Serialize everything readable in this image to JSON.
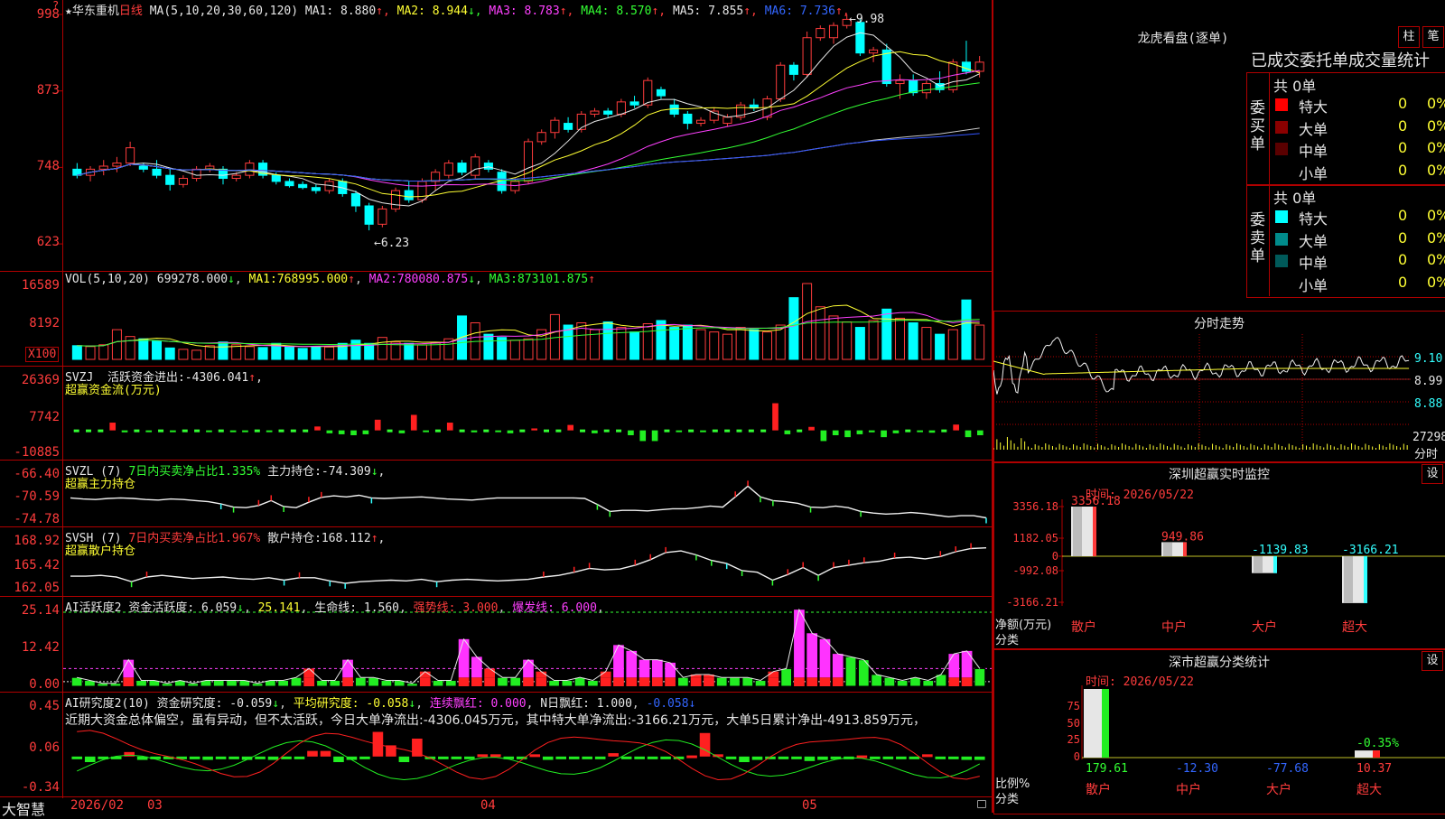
{
  "stock": {
    "star": "★",
    "name": "华东重机",
    "period": "日线",
    "ma_params": "MA(5,10,20,30,60,120)",
    "ma": [
      {
        "label": "MA1:",
        "value": "8.880",
        "arrow": "↑",
        "color": "#e6e6e6"
      },
      {
        "label": "MA2:",
        "value": "8.944",
        "arrow": "↓",
        "color": "#ffff33"
      },
      {
        "label": "MA3:",
        "value": "8.783",
        "arrow": "↑",
        "color": "#ff40ff"
      },
      {
        "label": "MA4:",
        "value": "8.570",
        "arrow": "↑",
        "color": "#33ff33"
      },
      {
        "label": "MA5:",
        "value": "7.855",
        "arrow": "↑",
        "color": "#e6e6e6"
      },
      {
        "label": "MA6:",
        "value": "7.736",
        "arrow": "↑",
        "color": "#3366ff"
      }
    ],
    "high_note": "9.98",
    "low_note": "6.23",
    "price_axis": [
      "998",
      "873",
      "748",
      "623"
    ]
  },
  "vol": {
    "params": "VOL(5,10,20)",
    "value": "699278.000",
    "value_arrow": "↓",
    "ma1_label": "MA1:",
    "ma1": "768995.000",
    "ma1_arrow": "↑",
    "ma2_label": "MA2:",
    "ma2": "780080.875",
    "ma2_arrow": "↓",
    "ma3_label": "MA3:",
    "ma3": "873101.875",
    "ma3_arrow": "↑",
    "axis": [
      "16589",
      "8192"
    ],
    "unit": "X100"
  },
  "svzj": {
    "name": "SVZJ",
    "label": "活跃资金进出:",
    "value": "-4306.041",
    "arrow": "↑",
    "tail": ",",
    "subtitle": "超赢资金流(万元)",
    "axis": [
      "26369",
      "7742",
      "-10885"
    ]
  },
  "svzl": {
    "name": "SVZL",
    "param": "(7)",
    "label1": "7日内买卖净占比1.335%",
    "label2": "主力持仓:",
    "value": "-74.309",
    "arrow": "↓",
    "tail": ",",
    "subtitle": "超赢主力持仓",
    "axis": [
      "-66.40",
      "-70.59",
      "-74.78"
    ]
  },
  "svsh": {
    "name": "SVSH",
    "param": "(7)",
    "label1": "7日内买卖净占比1.967%",
    "label2": "散户持仓:",
    "value": "168.112",
    "arrow": "↑",
    "tail": ",",
    "subtitle": "超赢散户持仓",
    "axis": [
      "168.92",
      "165.42",
      "162.05"
    ]
  },
  "ai_active": {
    "name": "AI活跃度2",
    "label": "资金活跃度:",
    "value": "6.059",
    "arrow": "↓",
    "v2": "25.141",
    "life_label": "生命线:",
    "life": "1.560",
    "strong_label": "强势线:",
    "strong": "3.000",
    "burst_label": "爆发线:",
    "burst": "6.000",
    "axis": [
      "25.14",
      "12.42",
      "0.00"
    ]
  },
  "ai_research": {
    "name": "AI研究度2(10)",
    "label": "资金研究度:",
    "value": "-0.059",
    "arrow": "↓",
    "avg_label": "平均研究度:",
    "avg": "-0.058",
    "avg_arrow": "↓",
    "red_label": "连续飘红:",
    "red_val": "0.000",
    "n_label": "N日飘红:",
    "n_val": "1.000",
    "last": "-0.058",
    "last_arrow": "↓",
    "comment": "近期大资金总体偏空，虽有异动，但不太活跃，今日大单净流出:-4306.045万元，其中特大单净流出:-3166.21万元，大单5日累计净出-4913.859万元，",
    "axis": [
      "0.45",
      "0.06",
      "-0.34"
    ]
  },
  "bottom_bar": {
    "brand": "大智慧",
    "dates": [
      "2026/02",
      "03",
      "04",
      "05"
    ]
  },
  "dragon": {
    "title": "龙虎看盘(逐单)",
    "btn1": "柱",
    "btn2": "笔",
    "header": "已成交委托单成交量统计",
    "buy_side": "委买单",
    "sell_side": "委卖单",
    "buy_total": "共 0单",
    "sell_total": "共 0单",
    "buy_rows": [
      {
        "label": "特大",
        "count": "0",
        "pct": "0%",
        "color": "#ff0000"
      },
      {
        "label": "大单",
        "count": "0",
        "pct": "0%",
        "color": "#8b0000"
      },
      {
        "label": "中单",
        "count": "0",
        "pct": "0%",
        "color": "#5a0000"
      },
      {
        "label": "小单",
        "count": "0",
        "pct": "0%",
        "color": "#000000"
      }
    ],
    "sell_rows": [
      {
        "label": "特大",
        "count": "0",
        "pct": "0%",
        "color": "#00ffff"
      },
      {
        "label": "大单",
        "count": "0",
        "pct": "0%",
        "color": "#008b8b"
      },
      {
        "label": "中单",
        "count": "0",
        "pct": "0%",
        "color": "#005a5a"
      },
      {
        "label": "小单",
        "count": "0",
        "pct": "0%",
        "color": "#000000"
      }
    ]
  },
  "intraday": {
    "title": "分时走势",
    "axis": [
      "9.10",
      "8.99",
      "8.88",
      "27298"
    ],
    "unit": "分时"
  },
  "sz_monitor": {
    "title": "深圳超赢实时监控",
    "btn": "设",
    "time_label": "时间:",
    "time": "2026/05/22",
    "axis": [
      "3356.18",
      "1182.05",
      "0",
      "-992.08",
      "-3166.21"
    ],
    "y_title": "净额(万元)",
    "x_title": "分类",
    "bars": [
      {
        "cat": "散户",
        "label": "3356.18",
        "value": 3356.18
      },
      {
        "cat": "中户",
        "label": "949.86",
        "value": 949.86
      },
      {
        "cat": "大户",
        "label": "-1139.83",
        "value": -1139.83
      },
      {
        "cat": "超大",
        "label": "-3166.21",
        "value": -3166.21
      }
    ]
  },
  "sz_stats": {
    "title": "深市超赢分类统计",
    "btn": "设",
    "time_label": "时间:",
    "time": "2026/05/22",
    "axis": [
      "75",
      "50",
      "25",
      "0"
    ],
    "y_title": "比例%",
    "x_title": "分类",
    "bars": [
      {
        "cat": "散户",
        "label": "179.61",
        "value": 179.61
      },
      {
        "cat": "中户",
        "label": "-12.30",
        "value": -12.3
      },
      {
        "cat": "大户",
        "label": "-77.68",
        "value": -77.68
      },
      {
        "cat": "超大",
        "label": "10.37",
        "value": 10.37,
        "note": "-0.35%"
      }
    ]
  },
  "chart_data": [
    {
      "type": "candlestick",
      "title": "华东重机 日线",
      "ylim": [
        6.23,
        9.98
      ],
      "y_ticks": [
        9.98,
        8.73,
        7.48,
        6.23
      ],
      "x_ticks": [
        "2026/02",
        "03",
        "04",
        "05"
      ],
      "candles_ohlc": [
        [
          7.45,
          7.55,
          7.3,
          7.35
        ],
        [
          7.35,
          7.5,
          7.25,
          7.45
        ],
        [
          7.45,
          7.6,
          7.35,
          7.5
        ],
        [
          7.5,
          7.65,
          7.4,
          7.55
        ],
        [
          7.55,
          7.9,
          7.5,
          7.8
        ],
        [
          7.5,
          7.55,
          7.4,
          7.45
        ],
        [
          7.45,
          7.6,
          7.3,
          7.35
        ],
        [
          7.35,
          7.45,
          7.1,
          7.2
        ],
        [
          7.2,
          7.35,
          7.15,
          7.3
        ],
        [
          7.3,
          7.5,
          7.25,
          7.45
        ],
        [
          7.45,
          7.55,
          7.4,
          7.5
        ],
        [
          7.45,
          7.5,
          7.2,
          7.3
        ],
        [
          7.3,
          7.4,
          7.25,
          7.35
        ],
        [
          7.35,
          7.6,
          7.3,
          7.55
        ],
        [
          7.55,
          7.6,
          7.3,
          7.35
        ],
        [
          7.35,
          7.4,
          7.2,
          7.25
        ],
        [
          7.25,
          7.3,
          7.15,
          7.18
        ],
        [
          7.2,
          7.25,
          7.12,
          7.15
        ],
        [
          7.15,
          7.2,
          7.05,
          7.1
        ],
        [
          7.1,
          7.3,
          7.05,
          7.25
        ],
        [
          7.25,
          7.3,
          7.0,
          7.05
        ],
        [
          7.05,
          7.1,
          6.75,
          6.85
        ],
        [
          6.85,
          6.9,
          6.45,
          6.55
        ],
        [
          6.55,
          6.85,
          6.5,
          6.8
        ],
        [
          6.8,
          7.15,
          6.75,
          7.1
        ],
        [
          7.1,
          7.25,
          6.9,
          6.95
        ],
        [
          6.95,
          7.3,
          6.9,
          7.25
        ],
        [
          7.25,
          7.45,
          7.1,
          7.4
        ],
        [
          7.35,
          7.6,
          7.3,
          7.55
        ],
        [
          7.55,
          7.6,
          7.35,
          7.4
        ],
        [
          7.35,
          7.7,
          7.3,
          7.65
        ],
        [
          7.55,
          7.6,
          7.4,
          7.45
        ],
        [
          7.4,
          7.45,
          7.05,
          7.1
        ],
        [
          7.1,
          7.3,
          7.05,
          7.25
        ],
        [
          7.25,
          7.95,
          7.2,
          7.9
        ],
        [
          7.9,
          8.1,
          7.85,
          8.05
        ],
        [
          8.05,
          8.3,
          7.95,
          8.25
        ],
        [
          8.2,
          8.3,
          8.05,
          8.1
        ],
        [
          8.1,
          8.4,
          8.05,
          8.35
        ],
        [
          8.35,
          8.45,
          8.3,
          8.4
        ],
        [
          8.4,
          8.45,
          8.3,
          8.35
        ],
        [
          8.35,
          8.6,
          8.3,
          8.55
        ],
        [
          8.55,
          8.65,
          8.45,
          8.5
        ],
        [
          8.5,
          8.95,
          8.45,
          8.9
        ],
        [
          8.75,
          8.8,
          8.6,
          8.65
        ],
        [
          8.5,
          8.6,
          8.3,
          8.35
        ],
        [
          8.35,
          8.4,
          8.1,
          8.2
        ],
        [
          8.2,
          8.3,
          8.15,
          8.25
        ],
        [
          8.25,
          8.45,
          8.2,
          8.4
        ],
        [
          8.2,
          8.35,
          8.15,
          8.3
        ],
        [
          8.3,
          8.55,
          8.25,
          8.5
        ],
        [
          8.5,
          8.6,
          8.4,
          8.45
        ],
        [
          8.3,
          8.65,
          8.25,
          8.6
        ],
        [
          8.6,
          9.2,
          8.55,
          9.15
        ],
        [
          9.15,
          9.2,
          8.9,
          9.0
        ],
        [
          9.0,
          9.7,
          8.95,
          9.6
        ],
        [
          9.6,
          9.8,
          9.55,
          9.75
        ],
        [
          9.6,
          9.85,
          9.5,
          9.8
        ],
        [
          9.8,
          9.98,
          9.75,
          9.9
        ],
        [
          9.85,
          9.9,
          9.3,
          9.35
        ],
        [
          9.35,
          9.45,
          9.2,
          9.4
        ],
        [
          9.4,
          9.5,
          8.8,
          8.85
        ],
        [
          8.85,
          9.0,
          8.6,
          8.9
        ],
        [
          8.9,
          9.0,
          8.65,
          8.7
        ],
        [
          8.7,
          8.9,
          8.6,
          8.85
        ],
        [
          8.85,
          9.05,
          8.7,
          8.75
        ],
        [
          8.75,
          9.25,
          8.7,
          9.2
        ],
        [
          9.2,
          9.55,
          9.0,
          9.05
        ],
        [
          9.05,
          9.3,
          8.95,
          9.2
        ]
      ],
      "series": [
        {
          "name": "MA1",
          "last": 8.88
        },
        {
          "name": "MA2",
          "last": 8.944
        },
        {
          "name": "MA3",
          "last": 8.783
        },
        {
          "name": "MA4",
          "last": 8.57
        },
        {
          "name": "MA5",
          "last": 7.855
        },
        {
          "name": "MA6",
          "last": 7.736
        }
      ]
    },
    {
      "type": "bar",
      "title": "VOL(5,10,20)",
      "ylim": [
        0,
        16589
      ],
      "y_ticks": [
        16589,
        8192
      ],
      "values": [
        3000,
        2800,
        3200,
        6500,
        5000,
        4500,
        4000,
        2500,
        2200,
        2000,
        3000,
        3800,
        3200,
        2800,
        2600,
        3500,
        2700,
        2400,
        2800,
        2700,
        3500,
        4200,
        3500,
        4800,
        3800,
        3500,
        3200,
        3600,
        4500,
        9500,
        8000,
        5500,
        4800,
        4200,
        4500,
        6500,
        9800,
        7500,
        8000,
        6500,
        8200,
        7000,
        6000,
        7800,
        8500,
        7000,
        7500,
        6500,
        6000,
        5500,
        7000,
        6500,
        6000,
        7500,
        13500,
        16589,
        11500,
        9500,
        8200,
        7000,
        8500,
        11000,
        9000,
        8000,
        7000,
        5500,
        6500,
        13000,
        7500
      ]
    },
    {
      "type": "bar",
      "title": "SVZJ",
      "ylim": [
        -10885,
        26369
      ],
      "y_ticks": [
        26369,
        7742,
        -10885
      ],
      "values": [
        0,
        0,
        0,
        4000,
        -1000,
        0,
        -800,
        0,
        -600,
        0,
        0,
        -500,
        0,
        -600,
        -500,
        0,
        -400,
        0,
        0,
        0,
        2000,
        -1500,
        -2000,
        -2500,
        -2000,
        5500,
        0,
        -1500,
        8000,
        -800,
        0,
        4000,
        0,
        -1000,
        0,
        -600,
        -1500,
        0,
        1000,
        0,
        0,
        2800,
        0,
        -1500,
        0,
        0,
        -2500,
        -5500,
        -5500,
        0,
        -800,
        0,
        -600,
        0,
        0,
        0,
        0,
        0,
        14000,
        -2000,
        0,
        1800,
        -5500,
        -2500,
        -3500,
        -2000,
        -1000,
        -3500,
        -1500,
        0,
        -800,
        -1200,
        0,
        3000,
        -3500,
        -2500
      ]
    },
    {
      "type": "line",
      "title": "SVZL (7)",
      "ylim": [
        -74.78,
        -66.4
      ],
      "y_ticks": [
        -66.4,
        -70.59,
        -74.78
      ],
      "values": [
        -71.0,
        -71.2,
        -71.3,
        -71.1,
        -71.0,
        -71.1,
        -71.3,
        -71.4,
        -71.2,
        -71.3,
        -71.5,
        -71.7,
        -72.1,
        -72.7,
        -72.8,
        -72.4,
        -71.5,
        -72.6,
        -72.8,
        -71.8,
        -70.9,
        -70.6,
        -70.8,
        -70.5,
        -71.0,
        -71.1,
        -71.0,
        -70.9,
        -70.8,
        -71.0,
        -71.2,
        -71.3,
        -71.4,
        -71.2,
        -71.0,
        -71.0,
        -71.0,
        -71.0,
        -71.0,
        -71.0,
        -71.0,
        -71.1,
        -72.2,
        -73.5,
        -73.3,
        -73.3,
        -73.4,
        -73.2,
        -73.0,
        -73.0,
        -72.8,
        -72.5,
        -72.7,
        -70.8,
        -68.8,
        -70.8,
        -71.5,
        -71.7,
        -72.0,
        -72.7,
        -72.8,
        -72.5,
        -72.8,
        -73.5,
        -73.8,
        -74.0,
        -73.9,
        -73.7,
        -73.9,
        -74.2,
        -74.5,
        -74.3,
        -74.3,
        -74.7
      ]
    },
    {
      "type": "line",
      "title": "SVSH (7)",
      "ylim": [
        162.05,
        168.92
      ],
      "y_ticks": [
        168.92,
        165.42,
        162.05
      ],
      "values": [
        164.1,
        164.1,
        164.2,
        164.0,
        163.4,
        164.0,
        164.2,
        164.0,
        163.8,
        163.9,
        164.0,
        163.8,
        163.7,
        163.9,
        163.6,
        163.9,
        163.9,
        163.5,
        163.2,
        163.4,
        163.5,
        163.6,
        163.5,
        163.7,
        163.4,
        163.6,
        163.7,
        163.6,
        163.5,
        163.6,
        163.7,
        164.0,
        164.2,
        164.6,
        165.1,
        164.9,
        165.0,
        165.5,
        166.2,
        167.1,
        167.3,
        166.8,
        166.1,
        165.7,
        164.8,
        164.6,
        163.6,
        164.3,
        165.2,
        164.2,
        165.2,
        165.5,
        165.8,
        166.0,
        166.4,
        166.5,
        166.3,
        166.6,
        167.2,
        167.6,
        167.7
      ]
    },
    {
      "type": "bar",
      "title": "AI活跃度2",
      "ylim": [
        0,
        25.14
      ],
      "y_ticks": [
        25.14,
        12.42,
        0.0
      ],
      "values": [
        3,
        2,
        1,
        1,
        9,
        2,
        2,
        1,
        2,
        1,
        2,
        2,
        2,
        2,
        1,
        2,
        2,
        3,
        6,
        2,
        2,
        9,
        3,
        3,
        2,
        2,
        1,
        5,
        2,
        2,
        16,
        10,
        6,
        3,
        3,
        9,
        5,
        2,
        2,
        3,
        2,
        5,
        14,
        12,
        9,
        9,
        8,
        3,
        4,
        4,
        3,
        3,
        3,
        2,
        5,
        6,
        26,
        18,
        16,
        11,
        10,
        9,
        4,
        3,
        2,
        3,
        2,
        4,
        11,
        12,
        6
      ],
      "burst_line": 6.0,
      "life_line": 1.56,
      "level_line": 25.141
    },
    {
      "type": "bar",
      "title": "AI研究度2(10)",
      "ylim": [
        -0.34,
        0.45
      ],
      "y_ticks": [
        0.45,
        0.06,
        -0.34
      ],
      "values": [
        0.0,
        -0.05,
        0.0,
        -0.02,
        0.04,
        -0.03,
        0.0,
        -0.01,
        0.0,
        -0.02,
        -0.03,
        -0.02,
        -0.02,
        -0.03,
        -0.02,
        -0.03,
        -0.02,
        0.0,
        0.05,
        0.05,
        -0.05,
        -0.03,
        0.0,
        0.22,
        0.1,
        -0.05,
        0.16,
        -0.02,
        0.0,
        0.0,
        -0.01,
        0.02,
        0.02,
        -0.02,
        -0.02,
        0.02,
        -0.03,
        0.0,
        0.0,
        -0.02,
        -0.01,
        0.03,
        -0.02,
        -0.02,
        -0.01,
        -0.01,
        0.0,
        0.01,
        0.21,
        0.02,
        -0.01,
        -0.05,
        -0.03,
        -0.02,
        -0.02,
        -0.02,
        -0.04,
        -0.03,
        -0.02,
        -0.01,
        0.01,
        -0.01,
        -0.02,
        -0.02,
        -0.02,
        0.02,
        0.0,
        -0.02,
        -0.03,
        -0.03
      ]
    }
  ]
}
